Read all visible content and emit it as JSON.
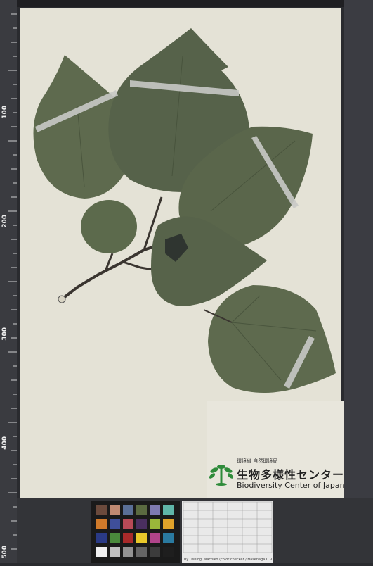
{
  "image": {
    "subject": "herbarium-specimen",
    "colors": {
      "paper": "#e4e2d6",
      "leaf": "#5e6a4e",
      "leaf_dark": "#4a553e",
      "tape": "#c8c9c6",
      "stem": "#3a3530",
      "frame": "#2a2b2f"
    }
  },
  "ruler_left": {
    "marks": [
      "100",
      "200",
      "300",
      "400",
      "500"
    ]
  },
  "logo": {
    "org_jp_small": "環境省 自然環境局",
    "title_jp": "生物多様性センター",
    "title_en": "Biodiversity Center of Japan"
  },
  "gray_card": {
    "caption": "By Ushiogi Machiko (color checker / Hasenaga C.-C.)"
  }
}
